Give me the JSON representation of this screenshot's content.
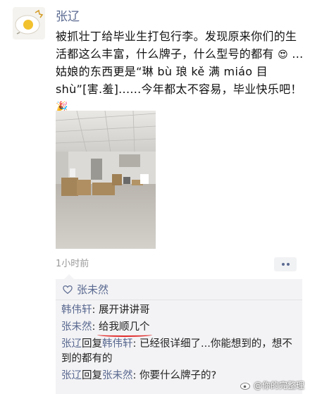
{
  "post": {
    "author": "张辽",
    "text_part1": "被抓壮丁给毕业生打包行李。发现原来你们的生活都这么丰富，什么牌子，什么型号的都有",
    "emoji_1": "😍",
    "text_part2": "...姑娘的东西更是“琳 bù 琅 kě 满 miáo 目 shù”[害.羞]......今年都太不容易，毕业快乐吧！",
    "emoji_2": "🎉",
    "time": "1小时前"
  },
  "likes": {
    "names": "张未然"
  },
  "comments": [
    {
      "name": "韩伟轩",
      "text": ": 展开讲讲哥"
    },
    {
      "name": "张未然",
      "text_plain": ": ",
      "text_marked": "给我顺几个"
    },
    {
      "name": "张辽",
      "reply_word": "回复",
      "reply_to": "韩伟轩",
      "text": ": 已经很详细了...你能想到的，想不到的都有的"
    },
    {
      "name": "张辽",
      "reply_word": "回复",
      "reply_to": "张未然",
      "text": ": 你要什么牌子的?"
    }
  ],
  "watermark": "@你的完整理",
  "colors": {
    "name_blue": "#5b6a91",
    "comment_bg": "#f3f3f5",
    "underline_red": "#e02a2a"
  },
  "icons": [
    "avatar-egg",
    "heart-icon",
    "more-dots-icon",
    "weibo-icon"
  ]
}
